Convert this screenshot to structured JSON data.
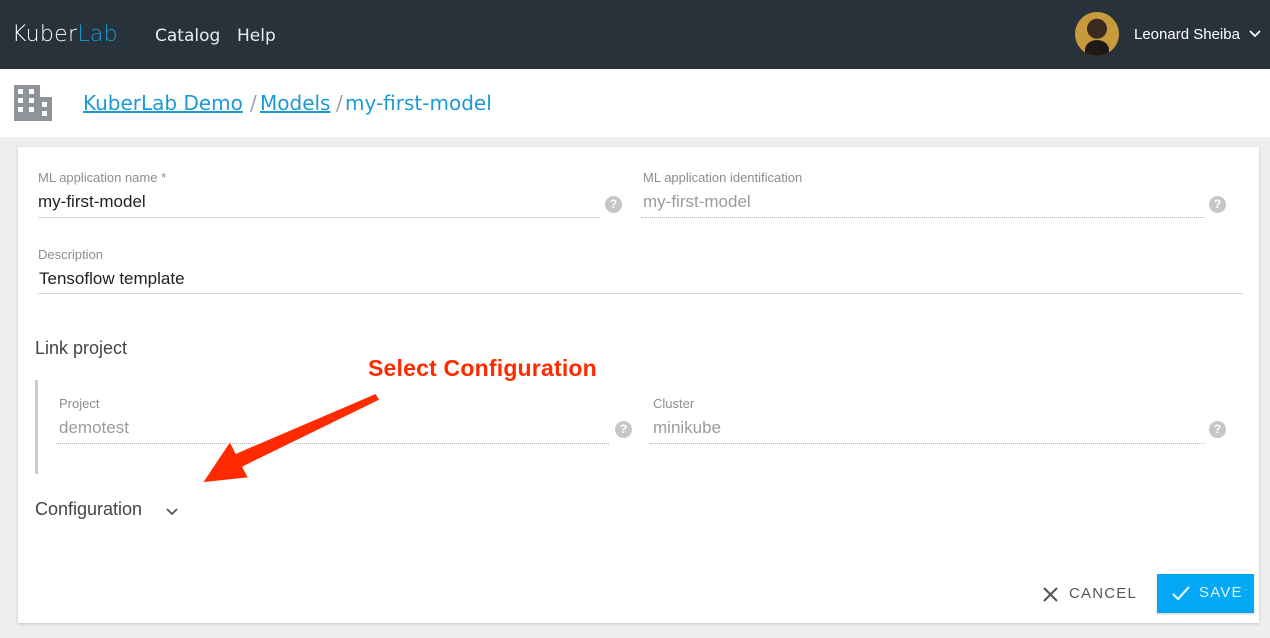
{
  "header": {
    "logo_primary": "Kuber",
    "logo_accent": "Lab",
    "nav": [
      {
        "label": "Catalog"
      },
      {
        "label": "Help"
      }
    ],
    "user_name": "Leonard Sheiba"
  },
  "breadcrumb": {
    "items": [
      {
        "label": "KuberLab Demo"
      },
      {
        "label": "Models"
      }
    ],
    "separator": "/",
    "current": "my-first-model"
  },
  "form": {
    "name_label": "ML application name *",
    "name_value": "my-first-model",
    "ident_label": "ML application identification",
    "ident_value": "my-first-model",
    "desc_label": "Description",
    "desc_value": "Tensoflow template",
    "help_symbol": "?"
  },
  "link_project": {
    "title": "Link project",
    "project_label": "Project",
    "project_value": "demotest",
    "cluster_label": "Cluster",
    "cluster_value": "minikube"
  },
  "configuration": {
    "label": "Configuration"
  },
  "annotation": {
    "text": "Select Configuration",
    "color": "#ff2a00"
  },
  "actions": {
    "cancel_label": "CANCEL",
    "save_label": "SAVE"
  },
  "colors": {
    "topbar": "#28323b",
    "accent": "#1b9ad6",
    "save_button": "#03a9f4"
  }
}
